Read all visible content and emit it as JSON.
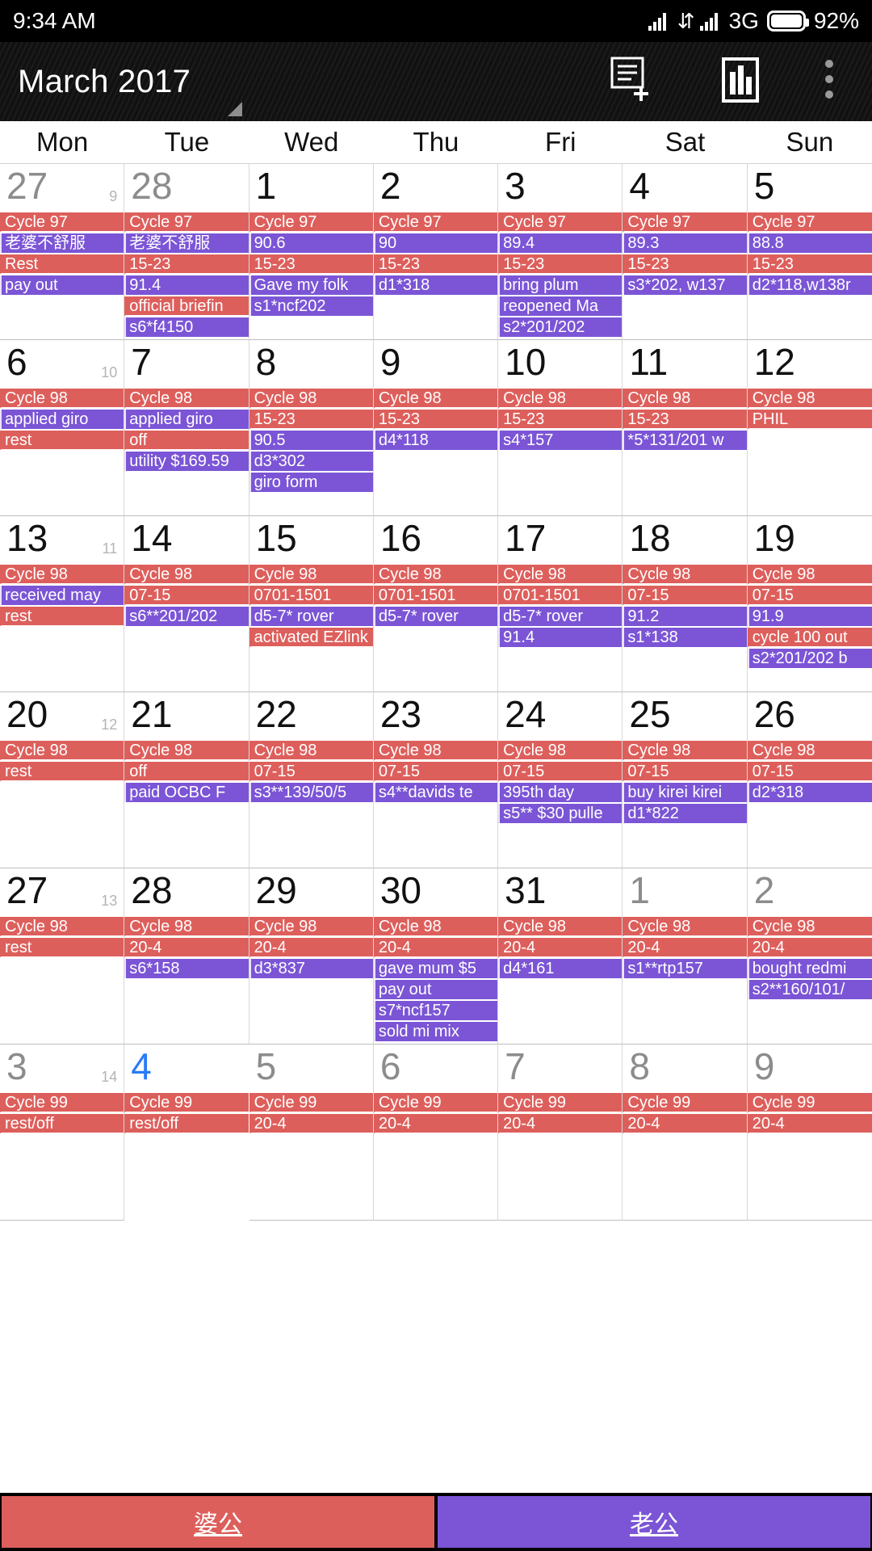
{
  "status_bar": {
    "time": "9:34 AM",
    "network": "3G",
    "battery": "92%",
    "icons": [
      "signal-bars-icon",
      "data-transfer-icon",
      "signal-bars-icon",
      "battery-icon"
    ]
  },
  "action_bar": {
    "title": "March 2017",
    "icons": [
      "new-event-icon",
      "statistics-icon",
      "overflow-menu-icon"
    ]
  },
  "weekdays": [
    "Mon",
    "Tue",
    "Wed",
    "Thu",
    "Fri",
    "Sat",
    "Sun"
  ],
  "bottom_bar": {
    "calendars": [
      {
        "label": "婆公",
        "color": "#dd5f5c"
      },
      {
        "label": "老公",
        "color": "#7b55d6"
      }
    ]
  },
  "colors": {
    "event_red": "#dd5f5c",
    "event_purple": "#7b55d6",
    "today_blue": "#2a7bf6",
    "selected_bg": "#b6c0e8"
  },
  "weeks": [
    {
      "week_number": "9",
      "days": [
        {
          "num": "27",
          "other_month": true,
          "bg": "pinkfull",
          "events": [
            {
              "t": "Cycle 97",
              "c": "red"
            },
            {
              "t": "老婆不舒服",
              "c": "purple"
            },
            {
              "t": "Rest",
              "c": "red"
            },
            {
              "t": "pay out",
              "c": "purple"
            }
          ]
        },
        {
          "num": "28",
          "other_month": true,
          "bg": "pinkfull",
          "events": [
            {
              "t": "Cycle 97",
              "c": "red"
            },
            {
              "t": "老婆不舒服",
              "c": "purple"
            },
            {
              "t": "15-23",
              "c": "red"
            },
            {
              "t": "91.4",
              "c": "purple"
            },
            {
              "t": "official briefin",
              "c": "red"
            },
            {
              "t": "s6*f4150",
              "c": "purple"
            }
          ]
        },
        {
          "num": "1",
          "other_month": false,
          "bg": "",
          "events": [
            {
              "t": "Cycle 97",
              "c": "red"
            },
            {
              "t": "90.6",
              "c": "purple"
            },
            {
              "t": "15-23",
              "c": "red"
            },
            {
              "t": "Gave my folk",
              "c": "purple"
            },
            {
              "t": "s1*ncf202",
              "c": "purple"
            }
          ]
        },
        {
          "num": "2",
          "other_month": false,
          "bg": "",
          "events": [
            {
              "t": "Cycle 97",
              "c": "red"
            },
            {
              "t": "90",
              "c": "purple"
            },
            {
              "t": "15-23",
              "c": "red"
            },
            {
              "t": "d1*318",
              "c": "purple"
            }
          ]
        },
        {
          "num": "3",
          "other_month": false,
          "bg": "",
          "events": [
            {
              "t": "Cycle 97",
              "c": "red"
            },
            {
              "t": "89.4",
              "c": "purple"
            },
            {
              "t": "15-23",
              "c": "red"
            },
            {
              "t": "bring plum",
              "c": "purple"
            },
            {
              "t": "reopened Ma",
              "c": "purple"
            },
            {
              "t": "s2*201/202",
              "c": "purple"
            }
          ]
        },
        {
          "num": "4",
          "other_month": false,
          "bg": "sat",
          "events": [
            {
              "t": "Cycle 97",
              "c": "red"
            },
            {
              "t": "89.3",
              "c": "purple"
            },
            {
              "t": "15-23",
              "c": "red"
            },
            {
              "t": "s3*202, w137",
              "c": "purple"
            }
          ]
        },
        {
          "num": "5",
          "other_month": false,
          "bg": "sun",
          "events": [
            {
              "t": "Cycle 97",
              "c": "red"
            },
            {
              "t": "88.8",
              "c": "purple"
            },
            {
              "t": "15-23",
              "c": "red"
            },
            {
              "t": "d2*118,w138r",
              "c": "purple"
            }
          ]
        }
      ]
    },
    {
      "week_number": "10",
      "days": [
        {
          "num": "6",
          "other_month": false,
          "bg": "",
          "events": [
            {
              "t": "Cycle 98",
              "c": "red"
            },
            {
              "t": "applied giro",
              "c": "purple"
            },
            {
              "t": "rest",
              "c": "red"
            }
          ]
        },
        {
          "num": "7",
          "other_month": false,
          "bg": "",
          "events": [
            {
              "t": "Cycle 98",
              "c": "red"
            },
            {
              "t": "applied giro",
              "c": "purple"
            },
            {
              "t": "off",
              "c": "red"
            },
            {
              "t": "utility $169.59",
              "c": "purple"
            }
          ]
        },
        {
          "num": "8",
          "other_month": false,
          "bg": "",
          "events": [
            {
              "t": "Cycle 98",
              "c": "red"
            },
            {
              "t": "15-23",
              "c": "red"
            },
            {
              "t": "90.5",
              "c": "purple"
            },
            {
              "t": "d3*302",
              "c": "purple"
            },
            {
              "t": "giro form",
              "c": "purple"
            }
          ]
        },
        {
          "num": "9",
          "other_month": false,
          "bg": "",
          "events": [
            {
              "t": "Cycle 98",
              "c": "red"
            },
            {
              "t": "15-23",
              "c": "red"
            },
            {
              "t": "d4*118",
              "c": "purple"
            }
          ]
        },
        {
          "num": "10",
          "other_month": false,
          "bg": "",
          "events": [
            {
              "t": "Cycle 98",
              "c": "red"
            },
            {
              "t": "15-23",
              "c": "red"
            },
            {
              "t": "s4*157",
              "c": "purple"
            }
          ]
        },
        {
          "num": "11",
          "other_month": false,
          "bg": "sat",
          "events": [
            {
              "t": "Cycle 98",
              "c": "red"
            },
            {
              "t": "15-23",
              "c": "red"
            },
            {
              "t": "*5*131/201 w",
              "c": "purple"
            }
          ]
        },
        {
          "num": "12",
          "other_month": false,
          "bg": "sun",
          "events": [
            {
              "t": "Cycle 98",
              "c": "red"
            },
            {
              "t": "PHIL",
              "c": "red"
            }
          ]
        }
      ]
    },
    {
      "week_number": "11",
      "days": [
        {
          "num": "13",
          "other_month": false,
          "bg": "",
          "events": [
            {
              "t": "Cycle 98",
              "c": "red"
            },
            {
              "t": "received may",
              "c": "purple"
            },
            {
              "t": "rest",
              "c": "red"
            }
          ]
        },
        {
          "num": "14",
          "other_month": false,
          "bg": "",
          "events": [
            {
              "t": "Cycle 98",
              "c": "red"
            },
            {
              "t": "07-15",
              "c": "red"
            },
            {
              "t": "s6**201/202",
              "c": "purple"
            }
          ]
        },
        {
          "num": "15",
          "other_month": false,
          "bg": "",
          "events": [
            {
              "t": "Cycle 98",
              "c": "red"
            },
            {
              "t": "0701-1501",
              "c": "red"
            },
            {
              "t": "d5-7* rover",
              "c": "purple"
            },
            {
              "t": "activated EZlink reloaded",
              "c": "red"
            }
          ]
        },
        {
          "num": "16",
          "other_month": false,
          "bg": "",
          "events": [
            {
              "t": "Cycle 98",
              "c": "red"
            },
            {
              "t": "0701-1501",
              "c": "red"
            },
            {
              "t": "d5-7* rover",
              "c": "purple"
            }
          ]
        },
        {
          "num": "17",
          "other_month": false,
          "bg": "",
          "events": [
            {
              "t": "Cycle 98",
              "c": "red"
            },
            {
              "t": "0701-1501",
              "c": "red"
            },
            {
              "t": "d5-7* rover",
              "c": "purple"
            },
            {
              "t": "91.4",
              "c": "purple"
            }
          ]
        },
        {
          "num": "18",
          "other_month": false,
          "bg": "sat",
          "events": [
            {
              "t": "Cycle 98",
              "c": "red"
            },
            {
              "t": "07-15",
              "c": "red"
            },
            {
              "t": "91.2",
              "c": "purple"
            },
            {
              "t": "s1*138",
              "c": "purple"
            }
          ]
        },
        {
          "num": "19",
          "other_month": false,
          "bg": "sun",
          "events": [
            {
              "t": "Cycle 98",
              "c": "red"
            },
            {
              "t": "07-15",
              "c": "red"
            },
            {
              "t": "91.9",
              "c": "purple"
            },
            {
              "t": "cycle 100 out",
              "c": "red"
            },
            {
              "t": "s2*201/202 b",
              "c": "purple"
            }
          ]
        }
      ]
    },
    {
      "week_number": "12",
      "days": [
        {
          "num": "20",
          "other_month": false,
          "bg": "",
          "events": [
            {
              "t": "Cycle 98",
              "c": "red"
            },
            {
              "t": "rest",
              "c": "red"
            }
          ]
        },
        {
          "num": "21",
          "other_month": false,
          "bg": "",
          "events": [
            {
              "t": "Cycle 98",
              "c": "red"
            },
            {
              "t": "off",
              "c": "red"
            },
            {
              "t": "paid OCBC F",
              "c": "purple"
            }
          ]
        },
        {
          "num": "22",
          "other_month": false,
          "bg": "",
          "events": [
            {
              "t": "Cycle 98",
              "c": "red"
            },
            {
              "t": "07-15",
              "c": "red"
            },
            {
              "t": "s3**139/50/5",
              "c": "purple"
            }
          ]
        },
        {
          "num": "23",
          "other_month": false,
          "bg": "",
          "events": [
            {
              "t": "Cycle 98",
              "c": "red"
            },
            {
              "t": "07-15",
              "c": "red"
            },
            {
              "t": "s4**davids te",
              "c": "purple"
            }
          ]
        },
        {
          "num": "24",
          "other_month": false,
          "bg": "",
          "events": [
            {
              "t": "Cycle 98",
              "c": "red"
            },
            {
              "t": "07-15",
              "c": "red"
            },
            {
              "t": "395th day",
              "c": "purple"
            },
            {
              "t": "s5** $30 pulle",
              "c": "purple"
            }
          ]
        },
        {
          "num": "25",
          "other_month": false,
          "bg": "sat",
          "events": [
            {
              "t": "Cycle 98",
              "c": "red"
            },
            {
              "t": "07-15",
              "c": "red"
            },
            {
              "t": "buy kirei kirei",
              "c": "purple"
            },
            {
              "t": "d1*822",
              "c": "purple"
            }
          ]
        },
        {
          "num": "26",
          "other_month": false,
          "bg": "sun",
          "events": [
            {
              "t": "Cycle 98",
              "c": "red"
            },
            {
              "t": "07-15",
              "c": "red"
            },
            {
              "t": "d2*318",
              "c": "purple"
            }
          ]
        }
      ]
    },
    {
      "week_number": "13",
      "days": [
        {
          "num": "27",
          "other_month": false,
          "bg": "",
          "events": [
            {
              "t": "Cycle 98",
              "c": "red"
            },
            {
              "t": "rest",
              "c": "red"
            }
          ]
        },
        {
          "num": "28",
          "other_month": false,
          "bg": "",
          "events": [
            {
              "t": "Cycle 98",
              "c": "red"
            },
            {
              "t": "20-4",
              "c": "red"
            },
            {
              "t": "s6*158",
              "c": "purple"
            }
          ]
        },
        {
          "num": "29",
          "other_month": false,
          "bg": "",
          "events": [
            {
              "t": "Cycle 98",
              "c": "red"
            },
            {
              "t": "20-4",
              "c": "red"
            },
            {
              "t": "d3*837",
              "c": "purple"
            }
          ]
        },
        {
          "num": "30",
          "other_month": false,
          "bg": "",
          "events": [
            {
              "t": "Cycle 98",
              "c": "red"
            },
            {
              "t": "20-4",
              "c": "red"
            },
            {
              "t": "gave mum $5",
              "c": "purple"
            },
            {
              "t": "pay out",
              "c": "purple"
            },
            {
              "t": "s7*ncf157",
              "c": "purple"
            },
            {
              "t": "sold mi mix",
              "c": "purple"
            }
          ]
        },
        {
          "num": "31",
          "other_month": false,
          "bg": "",
          "events": [
            {
              "t": "Cycle 98",
              "c": "red"
            },
            {
              "t": "20-4",
              "c": "red"
            },
            {
              "t": "d4*161",
              "c": "purple"
            }
          ]
        },
        {
          "num": "1",
          "other_month": true,
          "bg": "pinksat",
          "events": [
            {
              "t": "Cycle 98",
              "c": "red"
            },
            {
              "t": "20-4",
              "c": "red"
            },
            {
              "t": "s1**rtp157",
              "c": "purple"
            }
          ]
        },
        {
          "num": "2",
          "other_month": true,
          "bg": "pinksun",
          "events": [
            {
              "t": "Cycle 98",
              "c": "red"
            },
            {
              "t": "20-4",
              "c": "red"
            },
            {
              "t": "bought redmi",
              "c": "purple"
            },
            {
              "t": "s2**160/101/",
              "c": "purple"
            }
          ]
        }
      ]
    },
    {
      "week_number": "14",
      "days": [
        {
          "num": "3",
          "other_month": true,
          "bg": "pinkmid",
          "events": [
            {
              "t": "Cycle 99",
              "c": "red"
            },
            {
              "t": "rest/off",
              "c": "red"
            }
          ]
        },
        {
          "num": "4",
          "other_month": true,
          "today": true,
          "selected": true,
          "bg": "selected",
          "events": [
            {
              "t": "Cycle 99",
              "c": "red"
            },
            {
              "t": "rest/off",
              "c": "red"
            }
          ]
        },
        {
          "num": "5",
          "other_month": true,
          "bg": "pinkmid",
          "events": [
            {
              "t": "Cycle 99",
              "c": "red"
            },
            {
              "t": "20-4",
              "c": "red"
            }
          ]
        },
        {
          "num": "6",
          "other_month": true,
          "bg": "pinkmid",
          "events": [
            {
              "t": "Cycle 99",
              "c": "red"
            },
            {
              "t": "20-4",
              "c": "red"
            }
          ]
        },
        {
          "num": "7",
          "other_month": true,
          "bg": "pinkmid",
          "events": [
            {
              "t": "Cycle 99",
              "c": "red"
            },
            {
              "t": "20-4",
              "c": "red"
            }
          ]
        },
        {
          "num": "8",
          "other_month": true,
          "bg": "pinksat",
          "events": [
            {
              "t": "Cycle 99",
              "c": "red"
            },
            {
              "t": "20-4",
              "c": "red"
            }
          ]
        },
        {
          "num": "9",
          "other_month": true,
          "bg": "pinksun",
          "events": [
            {
              "t": "Cycle 99",
              "c": "red"
            },
            {
              "t": "20-4",
              "c": "red"
            }
          ]
        }
      ]
    }
  ]
}
